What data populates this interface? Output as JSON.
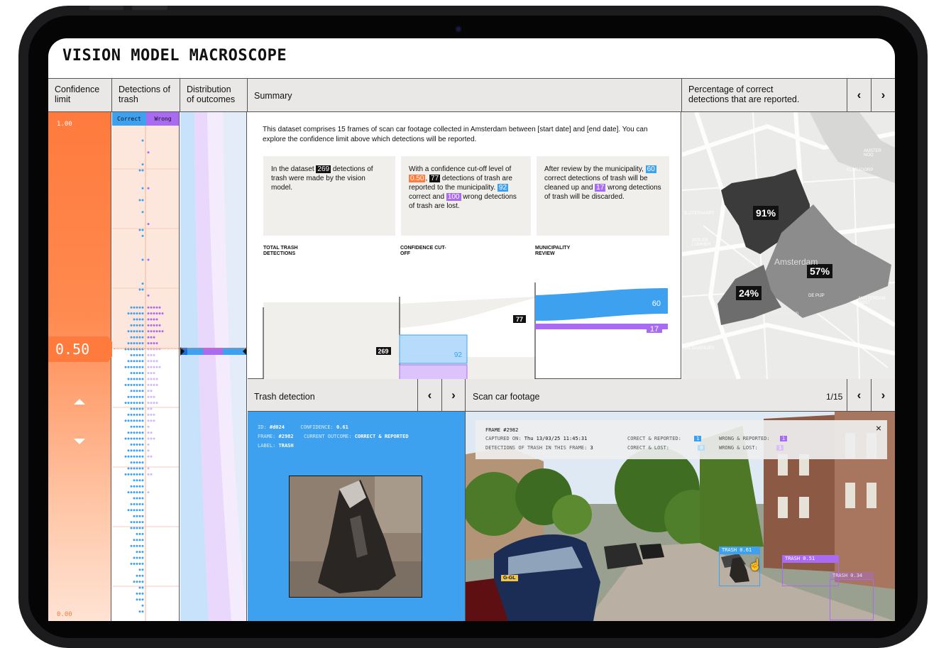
{
  "app": {
    "title": "VISION MODEL MACROSCOPE"
  },
  "columns": {
    "confidence": "Confidence limit",
    "detections": "Detections of trash",
    "distribution": "Distribution of outcomes",
    "summary": "Summary",
    "percentage": "Percentage of correct detections that are reported.",
    "trash_detection": "Trash detection",
    "footage": "Scan car footage"
  },
  "confidence": {
    "top": "1.00",
    "bottom": "0.00",
    "value": "0.50",
    "level": 0.5
  },
  "detections_legend": {
    "correct": "Correct",
    "wrong": "Wrong"
  },
  "summary": {
    "intro": "This dataset comprises 15 frames of scan car footage collected in Amsterdam between [start date] and [end date]. You can explore the confidence limit above which detections will be reported.",
    "box1": {
      "a": "In the dataset ",
      "n": "269",
      "b": " detections of trash were made by the vision model."
    },
    "box2": {
      "a": "With a confidence cut-off level of ",
      "cut": "0.50",
      "b": ", ",
      "n": "77",
      "c": " detections of trash are reported to the municipality. ",
      "lost_c": "92",
      "d": " correct and ",
      "lost_w": "100",
      "e": " wrong detections of trash are lost."
    },
    "box3": {
      "a": "After review by the municipality, ",
      "c": "60",
      "b": " correct detections of trash will be cleaned up and ",
      "w": "17",
      "d": " wrong detections of trash will be discarded."
    },
    "stages": {
      "total": "TOTAL TRASH DETECTIONS",
      "cutoff": "CONFIDENCE CUT-OFF",
      "review": "MUNICIPALITY REVIEW"
    },
    "flow": {
      "total": "269",
      "reported": "77",
      "lost_correct": "92",
      "lost_wrong": "100",
      "cleaned": "60",
      "discarded": "17"
    }
  },
  "map": {
    "pct1": "91%",
    "pct2": "57%",
    "pct3": "24%",
    "labels": {
      "amsterdam": "Amsterdam",
      "amster_ne": "AMSTER NOO",
      "floradorp": "FLORADORP",
      "slotervaart": "SLOTERVAART",
      "bos_lommer": "BOS EN LOMMER",
      "de_pijp": "DE PIJP",
      "rijksmuseum": "Rijksmuseum",
      "amsterdam_oost": "AMSTERDAM OOST",
      "de_baarsjes": "DE BAARSJES"
    }
  },
  "trash": {
    "id_label": "ID:",
    "id": "#d024",
    "conf_label": "CONFIDENCE:",
    "conf": "0.61",
    "frame_label": "FRAME:",
    "frame": "#2982",
    "outcome_label": "CURRENT OUTCOME:",
    "outcome": "CORRECT & REPORTED",
    "label_label": "LABEL:",
    "label": "TRASH"
  },
  "footage": {
    "counter": "1/15",
    "frame": "FRAME #2982",
    "captured_label": "CAPTURED ON:",
    "captured": "Thu 13/03/25 11:45:31",
    "det_label": "DETECTIONS OF TRASH IN THIS FRAME:",
    "det": "3",
    "cr_label": "CORECT & REPORTED:",
    "cr": "1",
    "cl_label": "CORECT & LOST:",
    "cl": "0",
    "wr_label": "WRONG & REPORTED:",
    "wr": "1",
    "wl_label": "WRONG & LOST:",
    "wl": "1",
    "close": "×",
    "plate": "G-GL",
    "boxes": [
      {
        "label": "TRASH 0.61",
        "outcome": "correct"
      },
      {
        "label": "TRASH 0.51",
        "outcome": "wrong"
      },
      {
        "label": "TRASH 0.34",
        "outcome": "wrong"
      }
    ]
  },
  "nav": {
    "prev": "‹",
    "next": "›"
  },
  "colors": {
    "orange": "#ff7a3d",
    "blue": "#3da1f0",
    "purple": "#a86bf2"
  }
}
